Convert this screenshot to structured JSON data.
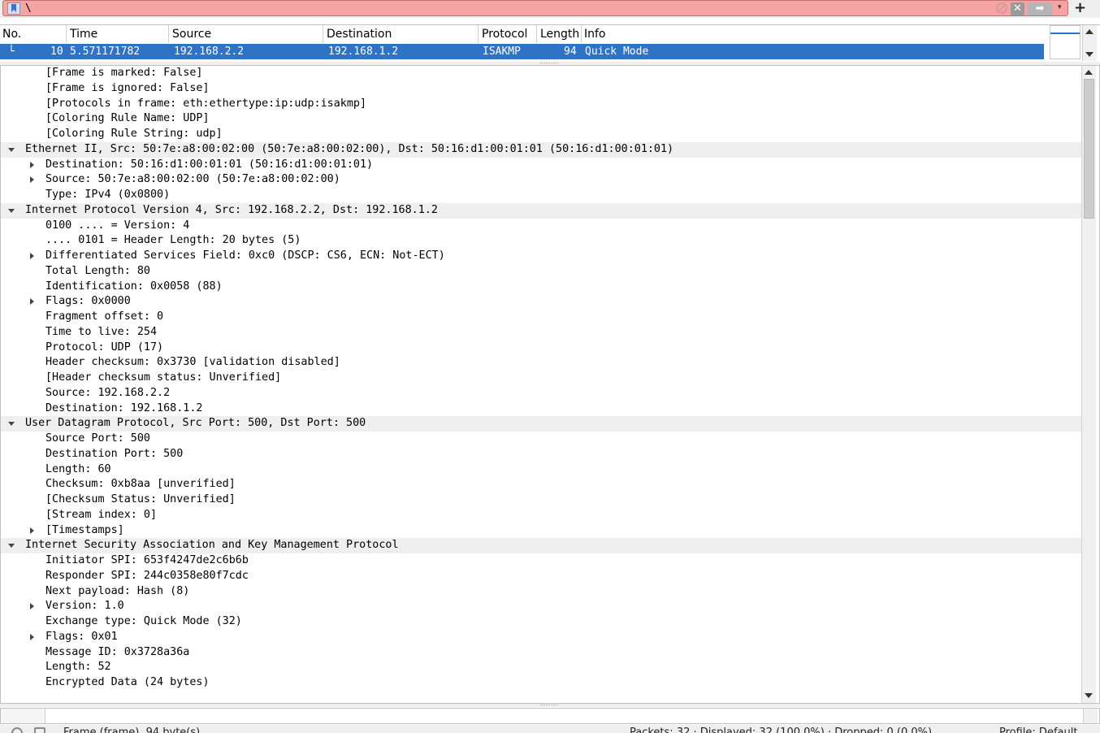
{
  "filter": {
    "value": "\\",
    "apply_label": "➡",
    "clear_label": "✕",
    "add_label": "+",
    "dropdown_label": "▾"
  },
  "packet_list": {
    "columns": [
      "No.",
      "Time",
      "Source",
      "Destination",
      "Protocol",
      "Length",
      "Info"
    ],
    "selected_row": {
      "no": "10",
      "time": "5.571171782",
      "source": "192.168.2.2",
      "destination": "192.168.1.2",
      "protocol": "ISAKMP",
      "length": "94",
      "info": "Quick Mode",
      "tree_marker": "└"
    }
  },
  "details": {
    "rows": [
      {
        "text": "[Frame is marked: False]",
        "depth": 1,
        "toggle": "none",
        "highlight": false
      },
      {
        "text": "[Frame is ignored: False]",
        "depth": 1,
        "toggle": "none",
        "highlight": false
      },
      {
        "text": "[Protocols in frame: eth:ethertype:ip:udp:isakmp]",
        "depth": 1,
        "toggle": "none",
        "highlight": false
      },
      {
        "text": "[Coloring Rule Name: UDP]",
        "depth": 1,
        "toggle": "none",
        "highlight": false
      },
      {
        "text": "[Coloring Rule String: udp]",
        "depth": 1,
        "toggle": "none",
        "highlight": false
      },
      {
        "text": "Ethernet II, Src: 50:7e:a8:00:02:00 (50:7e:a8:00:02:00), Dst: 50:16:d1:00:01:01 (50:16:d1:00:01:01)",
        "depth": 0,
        "toggle": "open",
        "highlight": true
      },
      {
        "text": "Destination: 50:16:d1:00:01:01 (50:16:d1:00:01:01)",
        "depth": 1,
        "toggle": "closed",
        "highlight": false
      },
      {
        "text": "Source: 50:7e:a8:00:02:00 (50:7e:a8:00:02:00)",
        "depth": 1,
        "toggle": "closed",
        "highlight": false
      },
      {
        "text": "Type: IPv4 (0x0800)",
        "depth": 1,
        "toggle": "none",
        "highlight": false
      },
      {
        "text": "Internet Protocol Version 4, Src: 192.168.2.2, Dst: 192.168.1.2",
        "depth": 0,
        "toggle": "open",
        "highlight": true
      },
      {
        "text": "0100 .... = Version: 4",
        "depth": 1,
        "toggle": "none",
        "highlight": false
      },
      {
        "text": ".... 0101 = Header Length: 20 bytes (5)",
        "depth": 1,
        "toggle": "none",
        "highlight": false
      },
      {
        "text": "Differentiated Services Field: 0xc0 (DSCP: CS6, ECN: Not-ECT)",
        "depth": 1,
        "toggle": "closed",
        "highlight": false
      },
      {
        "text": "Total Length: 80",
        "depth": 1,
        "toggle": "none",
        "highlight": false
      },
      {
        "text": "Identification: 0x0058 (88)",
        "depth": 1,
        "toggle": "none",
        "highlight": false
      },
      {
        "text": "Flags: 0x0000",
        "depth": 1,
        "toggle": "closed",
        "highlight": false
      },
      {
        "text": "Fragment offset: 0",
        "depth": 1,
        "toggle": "none",
        "highlight": false
      },
      {
        "text": "Time to live: 254",
        "depth": 1,
        "toggle": "none",
        "highlight": false
      },
      {
        "text": "Protocol: UDP (17)",
        "depth": 1,
        "toggle": "none",
        "highlight": false
      },
      {
        "text": "Header checksum: 0x3730 [validation disabled]",
        "depth": 1,
        "toggle": "none",
        "highlight": false
      },
      {
        "text": "[Header checksum status: Unverified]",
        "depth": 1,
        "toggle": "none",
        "highlight": false
      },
      {
        "text": "Source: 192.168.2.2",
        "depth": 1,
        "toggle": "none",
        "highlight": false
      },
      {
        "text": "Destination: 192.168.1.2",
        "depth": 1,
        "toggle": "none",
        "highlight": false
      },
      {
        "text": "User Datagram Protocol, Src Port: 500, Dst Port: 500",
        "depth": 0,
        "toggle": "open",
        "highlight": true
      },
      {
        "text": "Source Port: 500",
        "depth": 1,
        "toggle": "none",
        "highlight": false
      },
      {
        "text": "Destination Port: 500",
        "depth": 1,
        "toggle": "none",
        "highlight": false
      },
      {
        "text": "Length: 60",
        "depth": 1,
        "toggle": "none",
        "highlight": false
      },
      {
        "text": "Checksum: 0xb8aa [unverified]",
        "depth": 1,
        "toggle": "none",
        "highlight": false
      },
      {
        "text": "[Checksum Status: Unverified]",
        "depth": 1,
        "toggle": "none",
        "highlight": false
      },
      {
        "text": "[Stream index: 0]",
        "depth": 1,
        "toggle": "none",
        "highlight": false
      },
      {
        "text": "[Timestamps]",
        "depth": 1,
        "toggle": "closed",
        "highlight": false
      },
      {
        "text": "Internet Security Association and Key Management Protocol",
        "depth": 0,
        "toggle": "open",
        "highlight": true
      },
      {
        "text": "Initiator SPI: 653f4247de2c6b6b",
        "depth": 1,
        "toggle": "none",
        "highlight": false
      },
      {
        "text": "Responder SPI: 244c0358e80f7cdc",
        "depth": 1,
        "toggle": "none",
        "highlight": false
      },
      {
        "text": "Next payload: Hash (8)",
        "depth": 1,
        "toggle": "none",
        "highlight": false
      },
      {
        "text": "Version: 1.0",
        "depth": 1,
        "toggle": "closed",
        "highlight": false
      },
      {
        "text": "Exchange type: Quick Mode (32)",
        "depth": 1,
        "toggle": "none",
        "highlight": false
      },
      {
        "text": "Flags: 0x01",
        "depth": 1,
        "toggle": "closed",
        "highlight": false
      },
      {
        "text": "Message ID: 0x3728a36a",
        "depth": 1,
        "toggle": "none",
        "highlight": false
      },
      {
        "text": "Length: 52",
        "depth": 1,
        "toggle": "none",
        "highlight": false
      },
      {
        "text": "Encrypted Data (24 bytes)",
        "depth": 1,
        "toggle": "none",
        "highlight": false
      }
    ]
  },
  "status_bar": {
    "left_text": "Frame (frame), 94 byte(s)",
    "right_text": "Packets: 32 · Displayed: 32 (100.0%) · Dropped: 0 (0.0%)",
    "profile_text": "Profile: Default"
  }
}
